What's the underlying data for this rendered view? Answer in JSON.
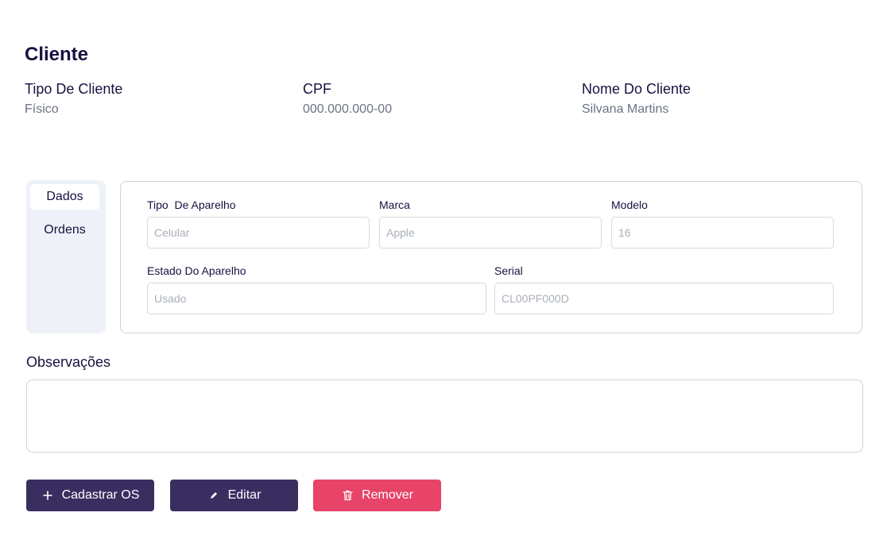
{
  "client": {
    "title": "Cliente",
    "tipo": {
      "label": "Tipo De Cliente",
      "value": "Físico"
    },
    "cpf": {
      "label": "CPF",
      "value": "000.000.000-00"
    },
    "nome": {
      "label": "Nome Do Cliente",
      "value": "Silvana Martins"
    }
  },
  "tabs": [
    {
      "label": "Dados",
      "active": true
    },
    {
      "label": "Ordens",
      "active": false
    }
  ],
  "device": {
    "tipo": {
      "label": "Tipo  De Aparelho",
      "placeholder": "Celular"
    },
    "marca": {
      "label": "Marca",
      "placeholder": "Apple"
    },
    "modelo": {
      "label": "Modelo",
      "placeholder": "16"
    },
    "estado": {
      "label": "Estado Do Aparelho",
      "placeholder": "Usado"
    },
    "serial": {
      "label": "Serial",
      "placeholder": "CL00PF000D"
    }
  },
  "observacoes": {
    "label": "Observações",
    "value": ""
  },
  "actions": {
    "cadastrar": {
      "label": "Cadastrar OS",
      "icon": "plus-icon"
    },
    "editar": {
      "label": "Editar",
      "icon": "pencil-icon"
    },
    "remover": {
      "label": "Remover",
      "icon": "trash-icon"
    }
  },
  "colors": {
    "primary": "#3a2e61",
    "danger": "#e84368",
    "heading": "#16123f",
    "muted": "#6b7384"
  }
}
